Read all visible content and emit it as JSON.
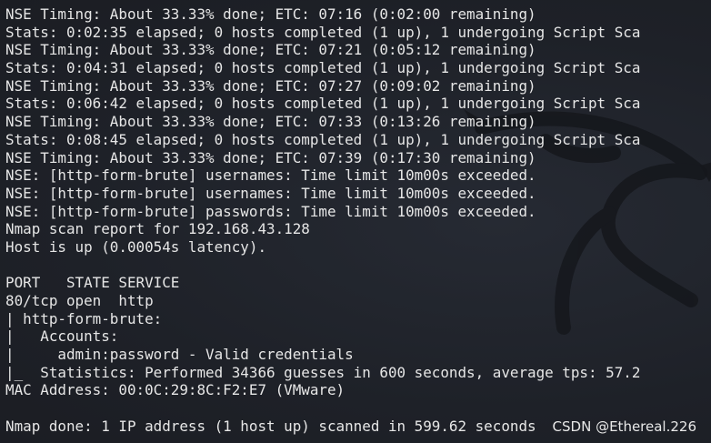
{
  "terminal": {
    "lines": [
      "NSE Timing: About 33.33% done; ETC: 07:16 (0:02:00 remaining)",
      "Stats: 0:02:35 elapsed; 0 hosts completed (1 up), 1 undergoing Script Sca",
      "NSE Timing: About 33.33% done; ETC: 07:21 (0:05:12 remaining)",
      "Stats: 0:04:31 elapsed; 0 hosts completed (1 up), 1 undergoing Script Sca",
      "NSE Timing: About 33.33% done; ETC: 07:27 (0:09:02 remaining)",
      "Stats: 0:06:42 elapsed; 0 hosts completed (1 up), 1 undergoing Script Sca",
      "NSE Timing: About 33.33% done; ETC: 07:33 (0:13:26 remaining)",
      "Stats: 0:08:45 elapsed; 0 hosts completed (1 up), 1 undergoing Script Sca",
      "NSE Timing: About 33.33% done; ETC: 07:39 (0:17:30 remaining)",
      "NSE: [http-form-brute] usernames: Time limit 10m00s exceeded.",
      "NSE: [http-form-brute] usernames: Time limit 10m00s exceeded.",
      "NSE: [http-form-brute] passwords: Time limit 10m00s exceeded.",
      "Nmap scan report for 192.168.43.128",
      "Host is up (0.00054s latency).",
      "",
      "PORT   STATE SERVICE",
      "80/tcp open  http",
      "| http-form-brute:",
      "|   Accounts:",
      "|     admin:password - Valid credentials",
      "|_  Statistics: Performed 34366 guesses in 600 seconds, average tps: 57.2",
      "MAC Address: 00:0C:29:8C:F2:E7 (VMware)",
      "",
      "Nmap done: 1 IP address (1 host up) scanned in 599.62 seconds"
    ]
  },
  "watermark": "CSDN @Ethereal.226"
}
